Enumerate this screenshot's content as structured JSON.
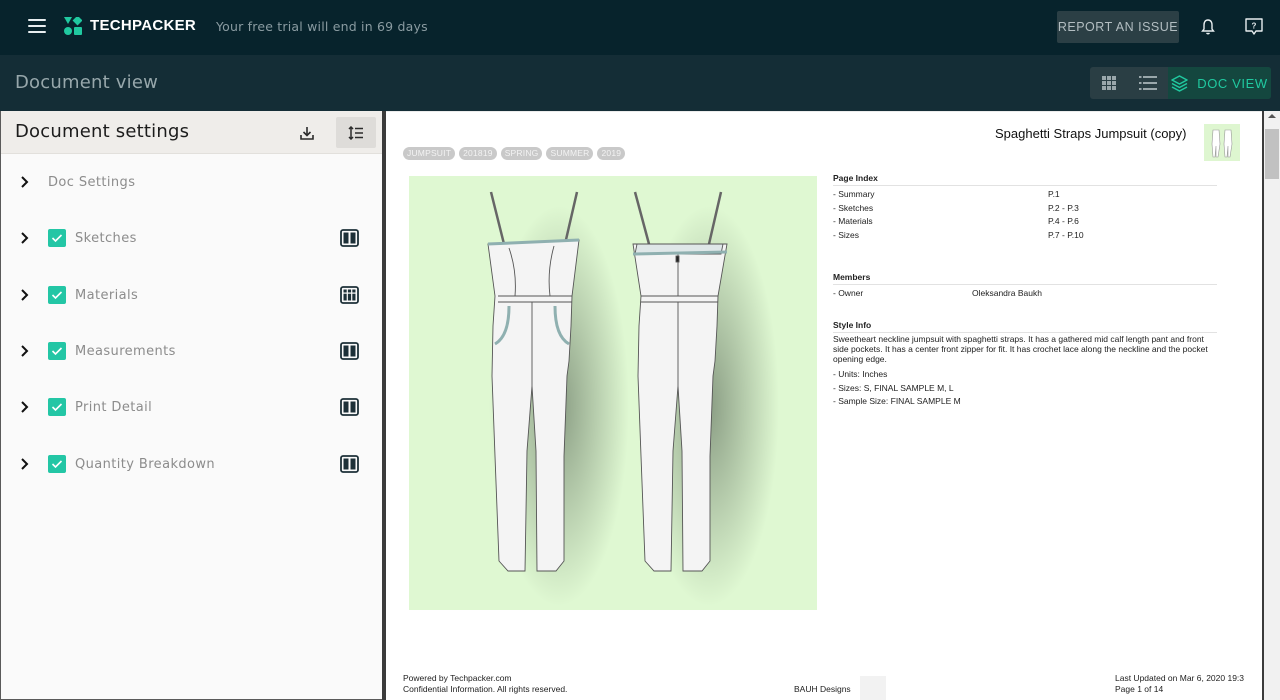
{
  "topbar": {
    "brand": "TECHPACKER",
    "trial_notice": "Your free trial will end in 69 days",
    "report_button": "REPORT AN ISSUE",
    "icons": [
      "menu-icon",
      "techpacker-logo",
      "bell-icon",
      "help-icon"
    ]
  },
  "subheader": {
    "title": "Document view",
    "view_toggle": {
      "options": [
        {
          "icon": "grid-icon",
          "label": ""
        },
        {
          "icon": "list-icon",
          "label": ""
        },
        {
          "icon": "layers-icon",
          "label": "DOC VIEW"
        }
      ],
      "selected": "DOC VIEW",
      "accent": "#20c9a0"
    }
  },
  "left_panel": {
    "title": "Document settings",
    "items": [
      {
        "label": "Doc Settings",
        "checked": null,
        "layout_icon": null
      },
      {
        "label": "Sketches",
        "checked": true,
        "layout_icon": "two-column-layout-icon"
      },
      {
        "label": "Materials",
        "checked": true,
        "layout_icon": "grid-layout-icon"
      },
      {
        "label": "Measurements",
        "checked": true,
        "layout_icon": "two-column-layout-icon"
      },
      {
        "label": "Print Detail",
        "checked": true,
        "layout_icon": "two-column-layout-icon"
      },
      {
        "label": "Quantity Breakdown",
        "checked": true,
        "layout_icon": "two-column-layout-icon"
      }
    ],
    "checkbox_color": "#23c6a5"
  },
  "document": {
    "tags": [
      "JUMPSUIT",
      "201819",
      "SPRING",
      "SUMMER",
      "2019"
    ],
    "title": "Spaghetti Straps Jumpsuit (copy)",
    "page_index": {
      "heading": "Page Index",
      "rows": [
        {
          "name": "- Summary",
          "pages": "P.1"
        },
        {
          "name": "- Sketches",
          "pages": "P.2 - P.3"
        },
        {
          "name": "- Materials",
          "pages": "P.4 - P.6"
        },
        {
          "name": "- Sizes",
          "pages": "P.7 - P.10"
        }
      ]
    },
    "members": {
      "heading": "Members",
      "rows": [
        {
          "role": "- Owner",
          "name": "Oleksandra Baukh"
        }
      ]
    },
    "style_info": {
      "heading": "Style Info",
      "description": "Sweetheart neckline jumpsuit with spaghetti straps. It has a gathered mid calf length pant and front side pockets. It has a center front zipper for fit. It has crochet lace along the neckline and the pocket opening edge.",
      "lines": [
        "- Units: Inches",
        "- Sizes: S, FINAL SAMPLE M, L",
        "- Sample Size: FINAL SAMPLE M"
      ]
    },
    "footer": {
      "powered_by": "Powered by Techpacker.com",
      "confidential": "Confidential Information. All rights reserved.",
      "company": "BAUH Designs",
      "last_updated": "Last Updated on Mar 6, 2020 19:3",
      "page": "Page 1 of 14"
    }
  }
}
